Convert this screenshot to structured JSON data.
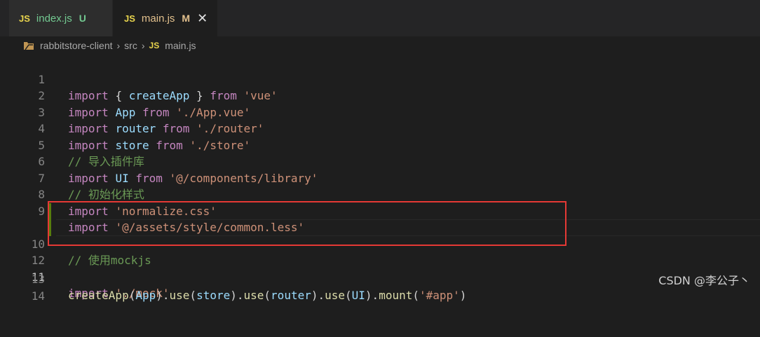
{
  "tabs": [
    {
      "icon": "JS",
      "name": "index.js",
      "badge": "U"
    },
    {
      "icon": "JS",
      "name": "main.js",
      "badge": "M",
      "close": "✕"
    }
  ],
  "breadcrumb": {
    "project": "rabbitstore-client",
    "sep1": "›",
    "folder": "src",
    "sep2": "›",
    "icon": "JS",
    "file": "main.js"
  },
  "code_lines": [
    {
      "n": "1"
    },
    {
      "n": "2"
    },
    {
      "n": "3"
    },
    {
      "n": "4"
    },
    {
      "n": "5"
    },
    {
      "n": "6"
    },
    {
      "n": "7"
    },
    {
      "n": "8"
    },
    {
      "n": "9"
    },
    {
      "n": "10"
    },
    {
      "n": "11"
    },
    {
      "n": "12"
    },
    {
      "n": "13"
    },
    {
      "n": "14"
    }
  ],
  "tokens": {
    "import": "import",
    "from": "from",
    "lb": "{ ",
    "rb": " }",
    "sp": " ",
    "createApp": "createApp",
    "App": "App",
    "router": "router",
    "store": "store",
    "UI": "UI",
    "vue": "'vue'",
    "appvue": "'./App.vue'",
    "routerp": "'./router'",
    "storep": "'./store'",
    "lib": "'@/components/library'",
    "norm": "'normalize.css'",
    "common": "'@/assets/style/common.less'",
    "mock": "'./mock'",
    "c1": "// 导入插件库",
    "c2": "// 初始化样式",
    "c3": "// 使用mockjs",
    "use": "use",
    "mount": "mount",
    "hash": "'#app'"
  },
  "watermark": "CSDN @李公子丶",
  "colors": {
    "keyword": "#569cd6",
    "import_kw": "#c586c0",
    "string": "#ce9178",
    "comment": "#6a9955",
    "highlight": "#e53935"
  }
}
